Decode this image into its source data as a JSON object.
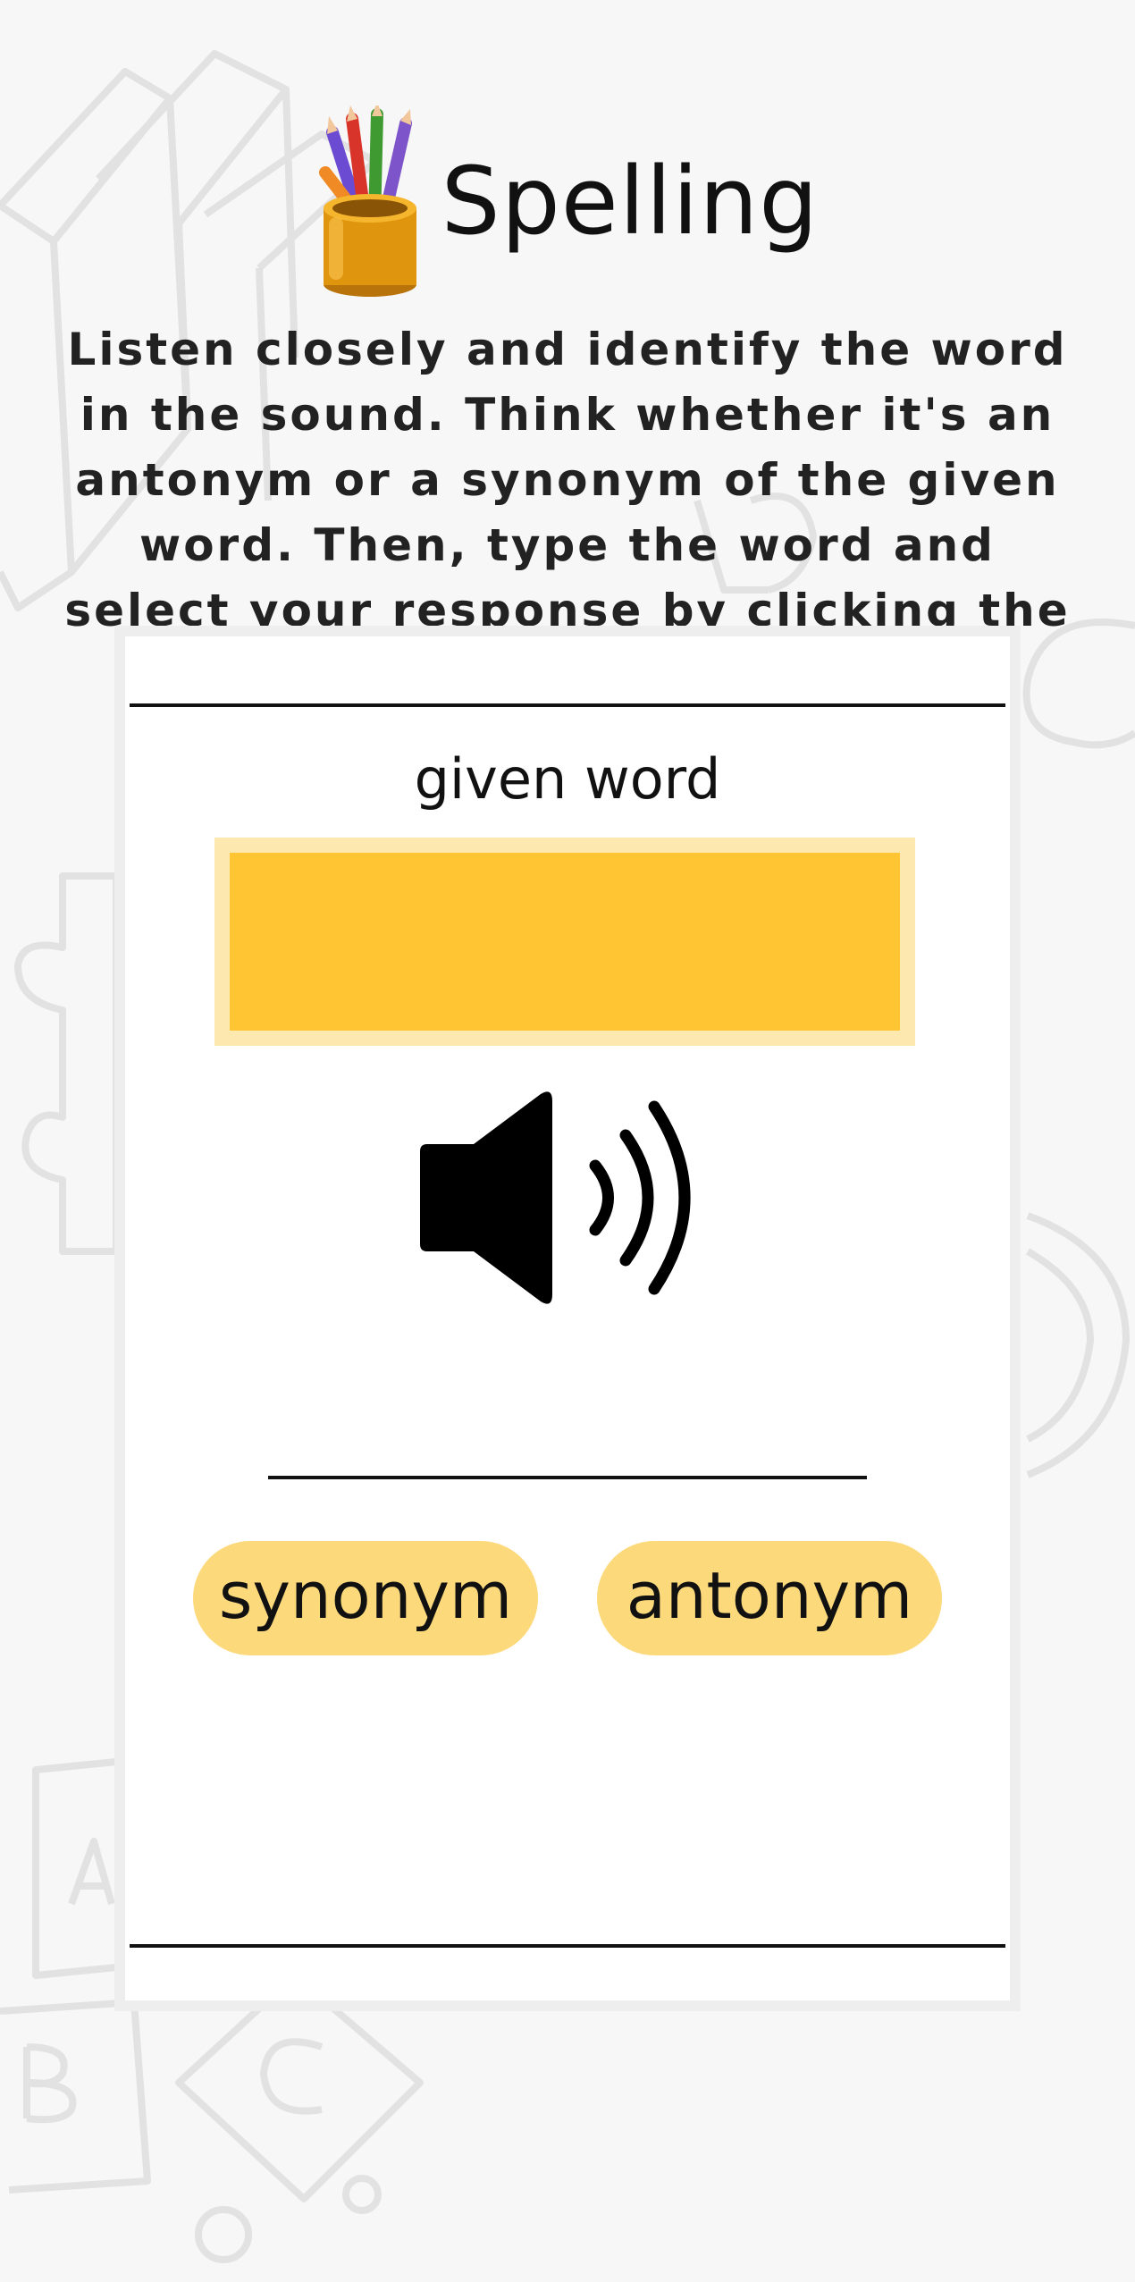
{
  "header": {
    "title": "Spelling",
    "icon": "pencil-cup-icon"
  },
  "instructions": "Listen closely and identify the word in the sound. Think whether it's an antonym or a synonym of the given word. Then, type the word and select your response by clicking the buttons.",
  "card": {
    "given_word_label": "given word",
    "given_word_value": "",
    "sound_icon": "speaker-icon",
    "answer_value": "",
    "choices": [
      "synonym",
      "antonym"
    ]
  },
  "colors": {
    "accent": "#ffc533",
    "accent_border": "#fde9b0",
    "button": "#fcd97b",
    "background": "#f7f7f7"
  }
}
